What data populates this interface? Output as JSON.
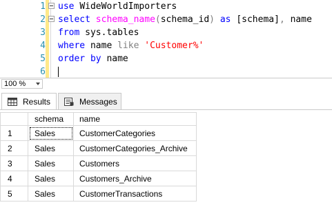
{
  "editor": {
    "lines": [
      {
        "num": "1",
        "tokens": [
          {
            "t": "use ",
            "c": "kw"
          },
          {
            "t": "WideWorldImporters",
            "c": "txt"
          }
        ]
      },
      {
        "num": "2",
        "tokens": [
          {
            "t": "select ",
            "c": "kw"
          },
          {
            "t": "schema_name",
            "c": "fn"
          },
          {
            "t": "(",
            "c": "op"
          },
          {
            "t": "schema_id",
            "c": "txt"
          },
          {
            "t": ") ",
            "c": "op"
          },
          {
            "t": "as ",
            "c": "kw"
          },
          {
            "t": "[schema]",
            "c": "txt"
          },
          {
            "t": ", ",
            "c": "op"
          },
          {
            "t": "name",
            "c": "txt"
          }
        ]
      },
      {
        "num": "3",
        "tokens": [
          {
            "t": "from ",
            "c": "kw"
          },
          {
            "t": "sys.tables",
            "c": "txt"
          }
        ]
      },
      {
        "num": "4",
        "tokens": [
          {
            "t": "where ",
            "c": "kw"
          },
          {
            "t": "name ",
            "c": "txt"
          },
          {
            "t": "like ",
            "c": "op"
          },
          {
            "t": "'Customer%'",
            "c": "str"
          }
        ]
      },
      {
        "num": "5",
        "tokens": [
          {
            "t": "order by ",
            "c": "kw"
          },
          {
            "t": "name",
            "c": "txt"
          }
        ]
      },
      {
        "num": "6",
        "tokens": []
      }
    ]
  },
  "zoom": {
    "value": "100 %"
  },
  "tabs": {
    "results_label": "Results",
    "messages_label": "Messages"
  },
  "grid": {
    "headers": {
      "rownum": "",
      "schema": "schema",
      "name": "name"
    },
    "rows": [
      {
        "num": "1",
        "schema": "Sales",
        "name": "CustomerCategories"
      },
      {
        "num": "2",
        "schema": "Sales",
        "name": "CustomerCategories_Archive"
      },
      {
        "num": "3",
        "schema": "Sales",
        "name": "Customers"
      },
      {
        "num": "4",
        "schema": "Sales",
        "name": "Customers_Archive"
      },
      {
        "num": "5",
        "schema": "Sales",
        "name": "CustomerTransactions"
      }
    ]
  },
  "colors": {
    "keyword": "#0000ff",
    "function": "#ff00ff",
    "string": "#ff0000",
    "line_number": "#2b91af",
    "change_bar": "#ffe98a"
  },
  "icons": {
    "results_tab": "grid-icon",
    "messages_tab": "messages-icon",
    "zoom_dropdown": "chevron-down-icon"
  }
}
